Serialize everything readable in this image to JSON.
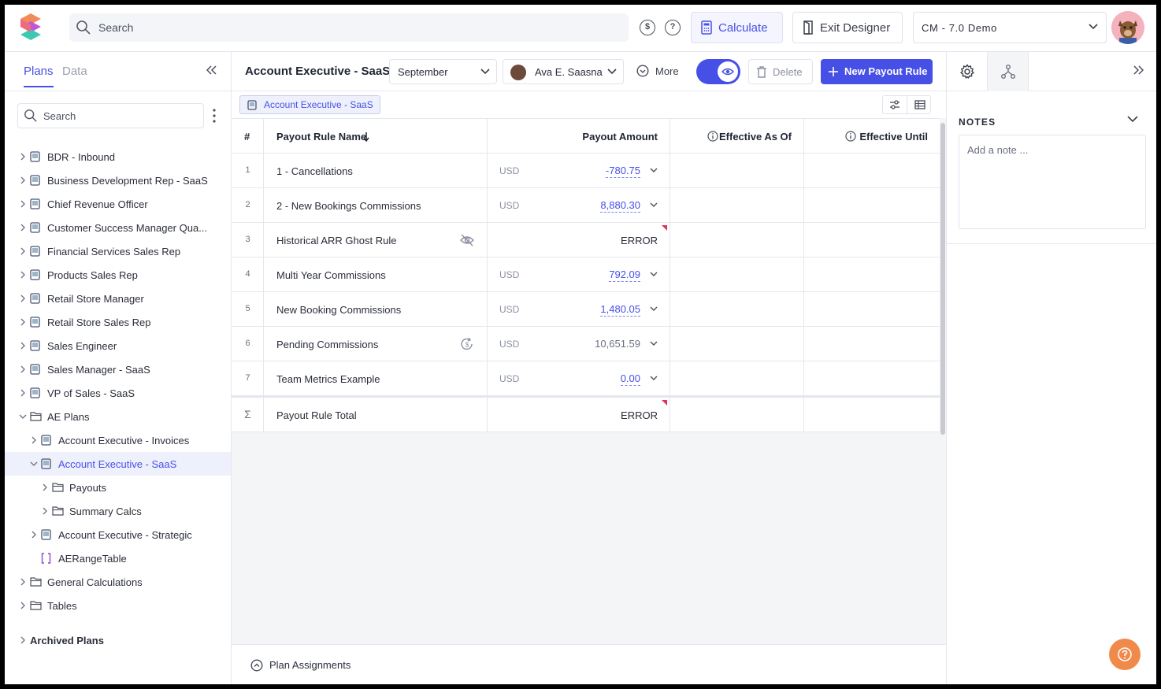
{
  "header": {
    "search_placeholder": "Search",
    "calculate_label": "Calculate",
    "exit_designer_label": "Exit Designer",
    "environment": "CM - 7.0 Demo",
    "dollar_icon_glyph": "$",
    "help_icon_glyph": "?"
  },
  "left_panel": {
    "tabs": [
      "Plans",
      "Data"
    ],
    "search_placeholder": "Search",
    "tree": [
      {
        "label": "BDR - Inbound",
        "icon": "plan-icon"
      },
      {
        "label": "Business Development Rep - SaaS",
        "icon": "plan-icon"
      },
      {
        "label": "Chief Revenue Officer",
        "icon": "plan-icon"
      },
      {
        "label": "Customer Success Manager Qua...",
        "icon": "plan-icon"
      },
      {
        "label": "Financial Services Sales Rep",
        "icon": "plan-icon"
      },
      {
        "label": "Products Sales Rep",
        "icon": "plan-icon"
      },
      {
        "label": "Retail Store Manager",
        "icon": "plan-icon"
      },
      {
        "label": "Retail Store Sales Rep",
        "icon": "plan-icon"
      },
      {
        "label": "Sales Engineer",
        "icon": "plan-icon"
      },
      {
        "label": "Sales Manager - SaaS",
        "icon": "plan-icon"
      },
      {
        "label": "VP of Sales - SaaS",
        "icon": "plan-icon"
      },
      {
        "label": "AE Plans",
        "icon": "folder-icon"
      },
      {
        "label": "Account Executive - Invoices",
        "icon": "plan-icon"
      },
      {
        "label": "Account Executive - SaaS",
        "icon": "plan-icon"
      },
      {
        "label": "Payouts",
        "icon": "folder-icon"
      },
      {
        "label": "Summary Calcs",
        "icon": "folder-icon"
      },
      {
        "label": "Account Executive - Strategic",
        "icon": "plan-icon"
      },
      {
        "label": "AERangeTable",
        "icon": "range-table-icon"
      },
      {
        "label": "General Calculations",
        "icon": "folder-icon"
      },
      {
        "label": "Tables",
        "icon": "folder-icon"
      }
    ],
    "archived_label": "Archived Plans"
  },
  "toolbar": {
    "plan_title": "Account Executive - SaaS",
    "period": "September",
    "user": "Ava E. Saasna",
    "more_label": "More",
    "delete_label": "Delete",
    "new_payout_rule_label": "New Payout Rule"
  },
  "breadcrumb": {
    "chip": "Account Executive - SaaS"
  },
  "table": {
    "columns": [
      "#",
      "Payout Rule Name",
      "Payout Amount",
      "Effective As Of",
      "Effective Until"
    ],
    "rows": [
      {
        "num": "1",
        "name": "1 - Cancellations",
        "currency": "USD",
        "amount": "-780.75"
      },
      {
        "num": "2",
        "name": "2 - New Bookings Commissions",
        "currency": "USD",
        "amount": "8,880.30"
      },
      {
        "num": "3",
        "name": "Historical ARR Ghost Rule",
        "currency": "",
        "amount": "ERROR"
      },
      {
        "num": "4",
        "name": "Multi Year Commissions",
        "currency": "USD",
        "amount": "792.09"
      },
      {
        "num": "5",
        "name": "New Booking Commissions",
        "currency": "USD",
        "amount": "1,480.05"
      },
      {
        "num": "6",
        "name": "Pending Commissions",
        "currency": "USD",
        "amount": "10,651.59"
      },
      {
        "num": "7",
        "name": "Team Metrics Example",
        "currency": "USD",
        "amount": "0.00"
      }
    ],
    "total_label": "Payout Rule Total",
    "total_value": "ERROR",
    "sigma": "Σ"
  },
  "plan_assignments_label": "Plan Assignments",
  "right_panel": {
    "notes_heading": "NOTES",
    "notes_placeholder": "Add a note ..."
  },
  "colors": {
    "accent": "#4750e6",
    "error_flag": "#e0335d",
    "help": "#f08a4b"
  }
}
